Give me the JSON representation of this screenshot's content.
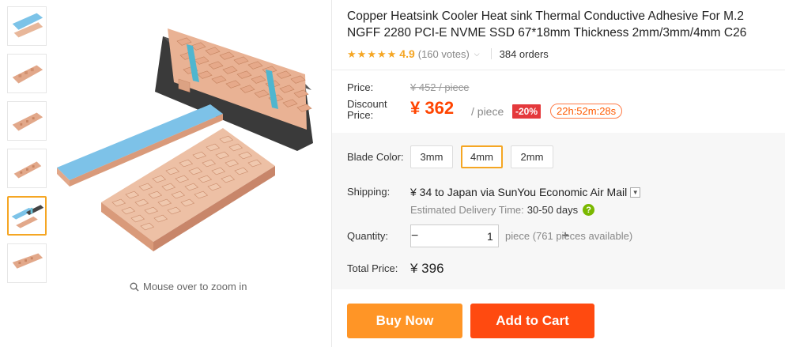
{
  "gallery": {
    "thumbnails": [
      "thumb-1",
      "thumb-2",
      "thumb-3",
      "thumb-4",
      "thumb-5",
      "thumb-6"
    ],
    "active_index": 4,
    "zoom_hint": "Mouse over to zoom in"
  },
  "product": {
    "title": "Copper Heatsink Cooler Heat sink Thermal Conductive Adhesive For M.2 NGFF 2280 PCI-E NVME SSD 67*18mm Thickness 2mm/3mm/4mm C26",
    "rating": "4.9",
    "stars": 5,
    "votes": "(160 votes)",
    "orders": "384 orders"
  },
  "pricing": {
    "price_label": "Price:",
    "original_price": "¥ 452 / piece",
    "discount_label": "Discount Price:",
    "discount_price": "¥ 362",
    "unit": "/ piece",
    "discount_badge": "-20%",
    "countdown": "22h:52m:28s"
  },
  "options": {
    "blade_label": "Blade Color:",
    "blade_options": [
      "3mm",
      "4mm",
      "2mm"
    ],
    "selected": "4mm"
  },
  "shipping": {
    "label": "Shipping:",
    "text": "¥ 34 to Japan via SunYou Economic Air Mail",
    "delivery_label": "Estimated Delivery Time:",
    "delivery_days": "30-50 days"
  },
  "quantity": {
    "label": "Quantity:",
    "value": "1",
    "minus": "−",
    "plus": "+",
    "note": "piece (761 pieces available)"
  },
  "total": {
    "label": "Total Price:",
    "value": "¥ 396"
  },
  "actions": {
    "buy_now": "Buy Now",
    "add_to_cart": "Add to Cart"
  },
  "colors": {
    "accent_orange": "#ff9526",
    "cart_red": "#ff4a10",
    "price_red": "#ff4400",
    "star": "#f5a623",
    "selected_border": "#f5a623"
  },
  "icons": {
    "zoom": "magnifier-icon",
    "help": "question-icon",
    "dropdown": "chevron-down-icon",
    "star": "star-icon"
  }
}
